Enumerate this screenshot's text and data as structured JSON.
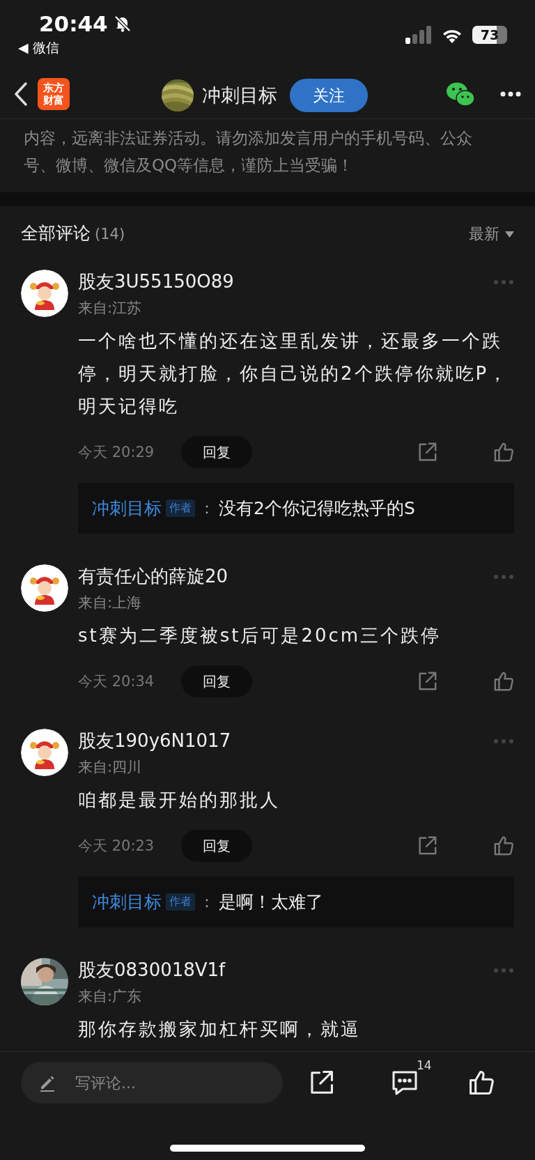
{
  "status_bar": {
    "time": "20:44",
    "back_app": "◀ 微信",
    "battery": "73"
  },
  "header": {
    "logo_lines": [
      "东方",
      "财富"
    ],
    "author": "冲刺目标",
    "follow_button": "关注"
  },
  "notice": "内容，远离非法证券活动。请勿添加发言用户的手机号码、公众号、微博、微信及QQ等信息，谨防上当受骗！",
  "comments_header": {
    "title": "全部评论",
    "count": "(14)",
    "sort": "最新"
  },
  "comments": [
    {
      "kind": "figure",
      "name": "股友3U55150O89",
      "region": "来自:江苏",
      "body": "一个啥也不懂的还在这里乱发讲，还最多一个跌停，明天就打脸，你自己说的2个跌停你就吃P，明天记得吃",
      "time": "今天 20:29",
      "reply_button": "回复",
      "replies": [
        {
          "author": "冲刺目标",
          "badge": "作者",
          "separator": "：",
          "text": "没有2个你记得吃热乎的S"
        }
      ]
    },
    {
      "kind": "figure",
      "name": "有责任心的薛旋20",
      "region": "来自:上海",
      "body": "st赛为二季度被st后可是20cm三个跌停",
      "time": "今天 20:34",
      "reply_button": "回复"
    },
    {
      "kind": "figure",
      "name": "股友190y6N1017",
      "region": "来自:四川",
      "body": "咱都是最开始的那批人",
      "time": "今天 20:23",
      "reply_button": "回复",
      "replies": [
        {
          "author": "冲刺目标",
          "badge": "作者",
          "separator": "：",
          "text": "是啊！太难了"
        }
      ]
    },
    {
      "kind": "picture",
      "name": "股友0830018V1f",
      "region": "来自:广东",
      "body": "那你存款搬家加杠杆买啊，就逼"
    }
  ],
  "bottom_bar": {
    "placeholder": "写评论...",
    "comment_count": "14"
  }
}
